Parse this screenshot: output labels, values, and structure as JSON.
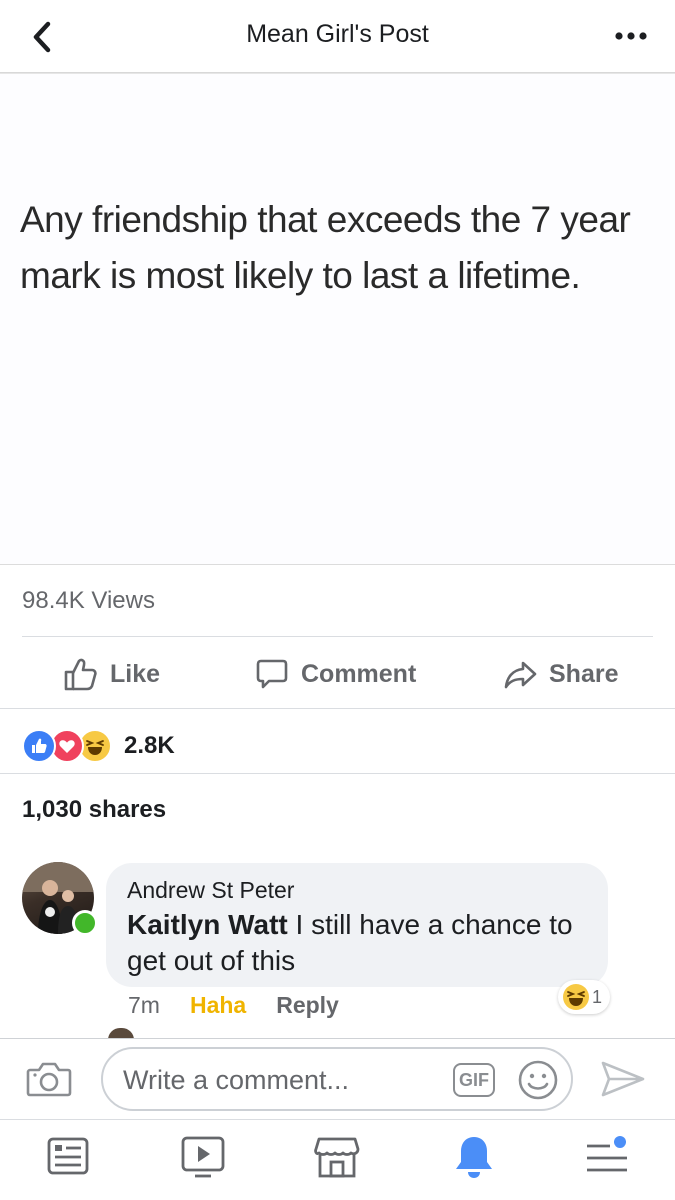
{
  "header": {
    "title": "Mean Girl's Post"
  },
  "post": {
    "text": "Any friendship that exceeds the 7 year mark is most likely to last a lifetime.",
    "views": "98.4K Views"
  },
  "actions": {
    "like": "Like",
    "comment": "Comment",
    "share": "Share"
  },
  "reactions": {
    "count": "2.8K",
    "types": [
      "like",
      "love",
      "haha"
    ]
  },
  "shares": "1,030 shares",
  "comment": {
    "author": "Andrew St Peter",
    "mention": "Kaitlyn Watt",
    "text": " I still have a chance to get out of this",
    "time": "7m",
    "reaction_label": "Haha",
    "reply_label": "Reply",
    "reaction_count": "1"
  },
  "composer": {
    "placeholder": "Write a comment...",
    "gif_label": "GIF"
  },
  "colors": {
    "facebook_blue": "#1877f2",
    "haha_yellow": "#f0b400",
    "online_green": "#42b72a"
  }
}
